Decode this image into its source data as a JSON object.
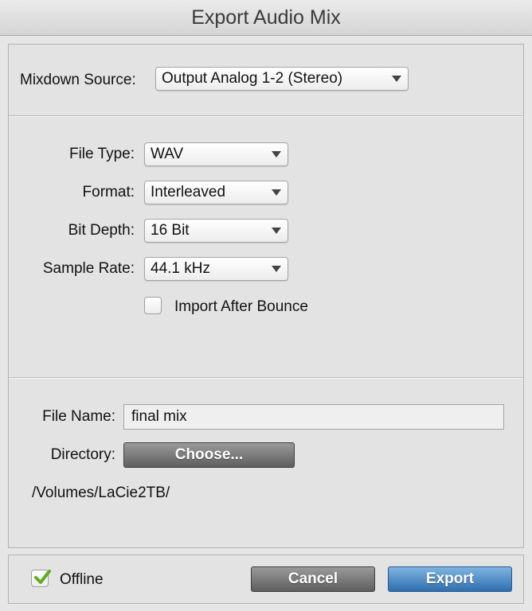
{
  "window": {
    "title": "Export Audio Mix"
  },
  "mixdown": {
    "label": "Mixdown Source:",
    "value": "Output Analog 1-2 (Stereo)"
  },
  "file_type": {
    "label": "File Type:",
    "value": "WAV"
  },
  "format": {
    "label": "Format:",
    "value": "Interleaved"
  },
  "bit_depth": {
    "label": "Bit Depth:",
    "value": "16 Bit"
  },
  "sample_rate": {
    "label": "Sample Rate:",
    "value": "44.1 kHz"
  },
  "import_after_bounce": {
    "label": "Import After Bounce",
    "checked": false
  },
  "file_name": {
    "label": "File Name:",
    "value": "final mix"
  },
  "directory": {
    "label": "Directory:",
    "button": "Choose...",
    "path": "/Volumes/LaCie2TB/"
  },
  "footer": {
    "offline_label": "Offline",
    "offline_checked": true,
    "cancel_label": "Cancel",
    "export_label": "Export"
  },
  "colors": {
    "primary": "#2f6fae",
    "check": "#5fae1e"
  }
}
